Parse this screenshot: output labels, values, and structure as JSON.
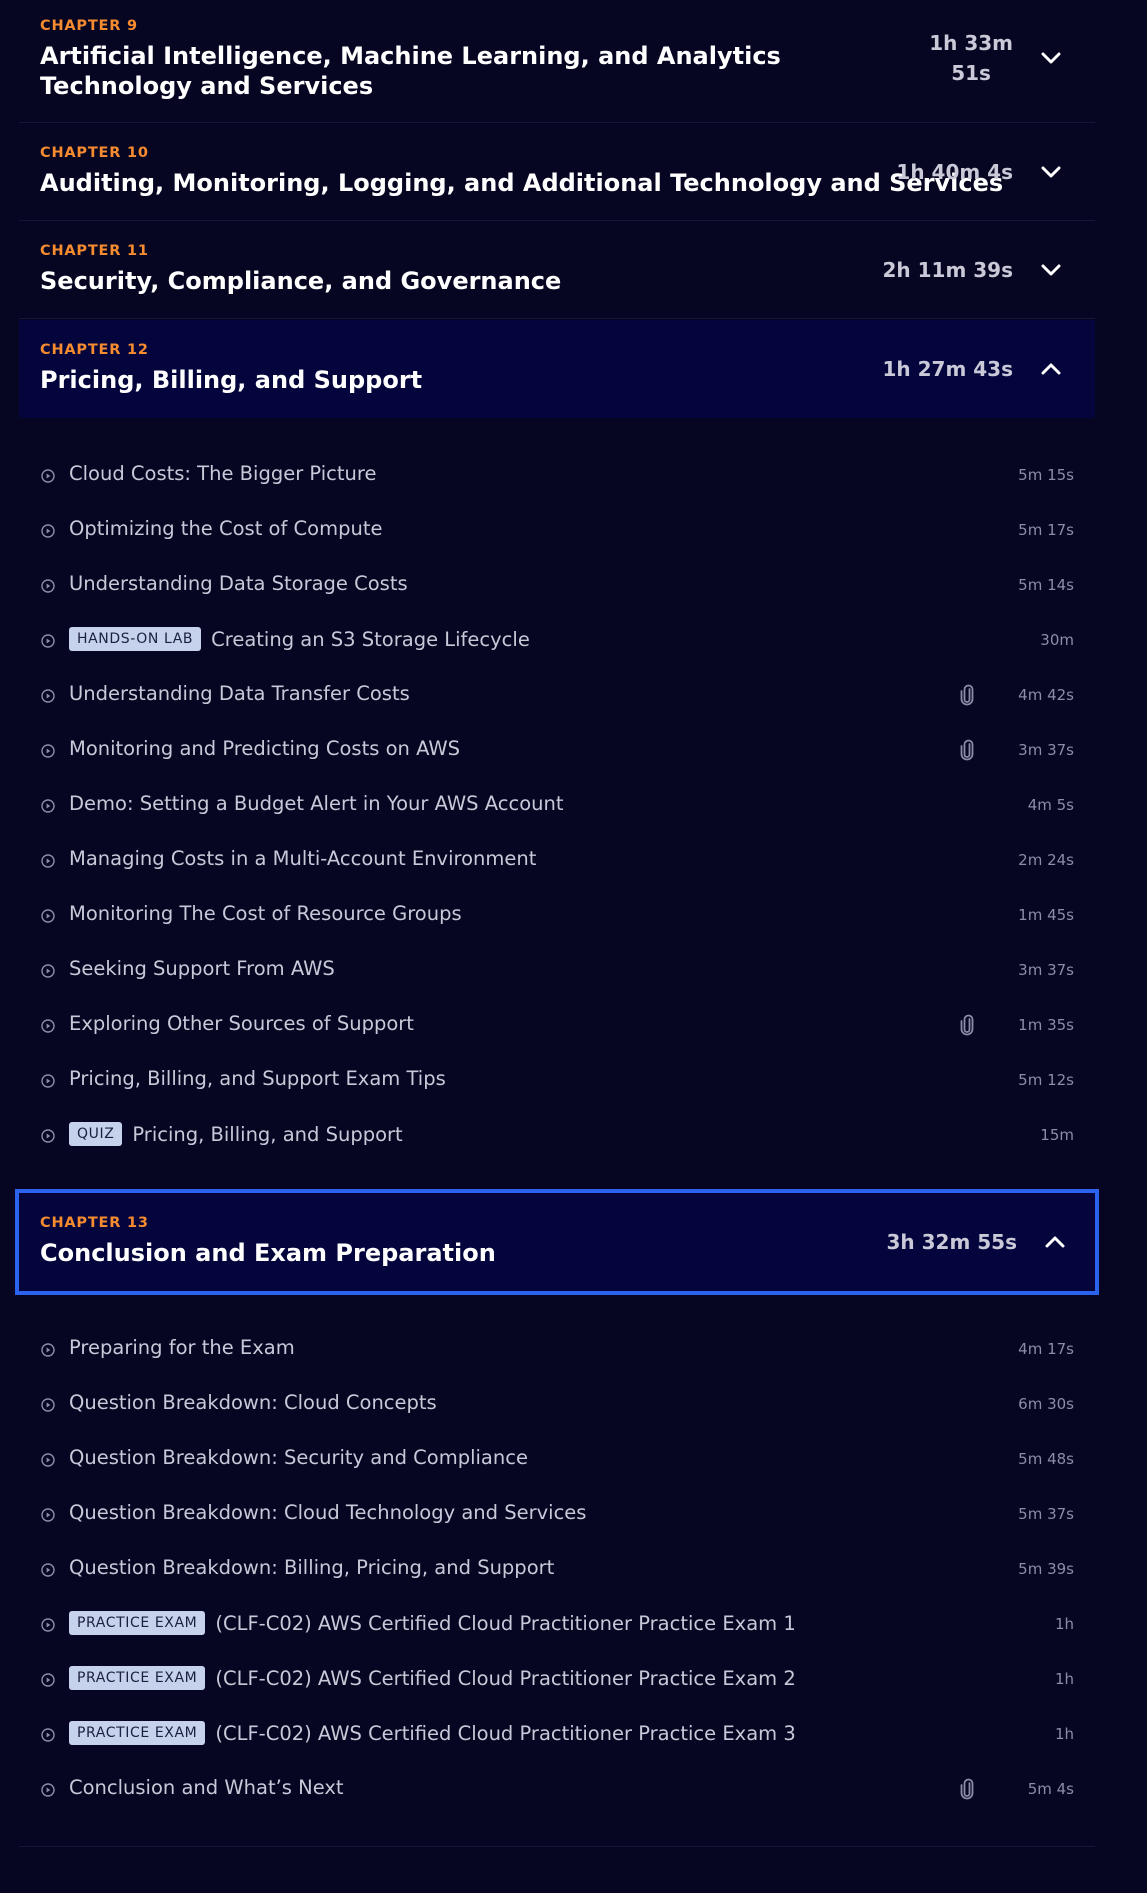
{
  "chapters_top": [
    {
      "label": "CHAPTER 9",
      "title": "Artificial Intelligence, Machine Learning, and Analytics Technology and Services",
      "duration_line1": "1h 33m",
      "duration_line2": "51s",
      "chevron": "chevron-down-icon"
    },
    {
      "label": "CHAPTER 10",
      "title": "Auditing, Monitoring, Logging, and Additional Technology and Services",
      "duration": "1h 40m 4s",
      "chevron": "chevron-down-icon"
    },
    {
      "label": "CHAPTER 11",
      "title": "Security, Compliance, and Governance",
      "duration": "2h 11m 39s",
      "chevron": "chevron-down-icon"
    },
    {
      "label": "CHAPTER 12",
      "title": "Pricing, Billing, and Support",
      "duration": "1h 27m 43s",
      "chevron": "chevron-up-icon"
    }
  ],
  "chapter12_items": [
    {
      "title": "Cloud Costs: The Bigger Picture",
      "duration": "5m 15s"
    },
    {
      "title": "Optimizing the Cost of Compute",
      "duration": "5m 17s"
    },
    {
      "title": "Understanding Data Storage Costs",
      "duration": "5m 14s"
    },
    {
      "badge": "HANDS-ON LAB",
      "title": "Creating an S3 Storage Lifecycle",
      "duration": "30m"
    },
    {
      "title": "Understanding Data Transfer Costs",
      "duration": "4m 42s",
      "attachment": "paperclip-icon"
    },
    {
      "title": "Monitoring and Predicting Costs on AWS",
      "duration": "3m 37s",
      "attachment": "paperclip-icon"
    },
    {
      "title": "Demo: Setting a Budget Alert in Your AWS Account",
      "duration": "4m 5s"
    },
    {
      "title": "Managing Costs in a Multi-Account Environment",
      "duration": "2m 24s"
    },
    {
      "title": "Monitoring The Cost of Resource Groups",
      "duration": "1m 45s"
    },
    {
      "title": "Seeking Support From AWS",
      "duration": "3m 37s"
    },
    {
      "title": "Exploring Other Sources of Support",
      "duration": "1m 35s",
      "attachment": "paperclip-icon"
    },
    {
      "title": "Pricing, Billing, and Support Exam Tips",
      "duration": "5m 12s"
    },
    {
      "badge": "QUIZ",
      "title": "Pricing, Billing, and Support",
      "duration": "15m"
    }
  ],
  "chapter13": {
    "label": "CHAPTER 13",
    "title": "Conclusion and Exam Preparation",
    "duration": "3h 32m 55s",
    "chevron": "chevron-up-icon"
  },
  "chapter13_items": [
    {
      "title": "Preparing for the Exam",
      "duration": "4m 17s"
    },
    {
      "title": "Question Breakdown: Cloud Concepts",
      "duration": "6m 30s"
    },
    {
      "title": "Question Breakdown: Security and Compliance",
      "duration": "5m 48s"
    },
    {
      "title": "Question Breakdown: Cloud Technology and Services",
      "duration": "5m 37s"
    },
    {
      "title": "Question Breakdown: Billing, Pricing, and Support",
      "duration": "5m 39s"
    },
    {
      "badge": "PRACTICE EXAM",
      "title": "(CLF-C02) AWS Certified Cloud Practitioner Practice Exam 1",
      "duration": "1h"
    },
    {
      "badge": "PRACTICE EXAM",
      "title": "(CLF-C02) AWS Certified Cloud Practitioner Practice Exam 2",
      "duration": "1h"
    },
    {
      "badge": "PRACTICE EXAM",
      "title": "(CLF-C02) AWS Certified Cloud Practitioner Practice Exam 3",
      "duration": "1h"
    },
    {
      "title": "Conclusion and What’s Next",
      "duration": "5m 4s",
      "attachment": "paperclip-icon"
    }
  ],
  "colors": {
    "background": "#060622",
    "chapter_label": "#f68b2f",
    "focus_border": "#2b63ef",
    "badge_bg": "#c6d2ec"
  }
}
